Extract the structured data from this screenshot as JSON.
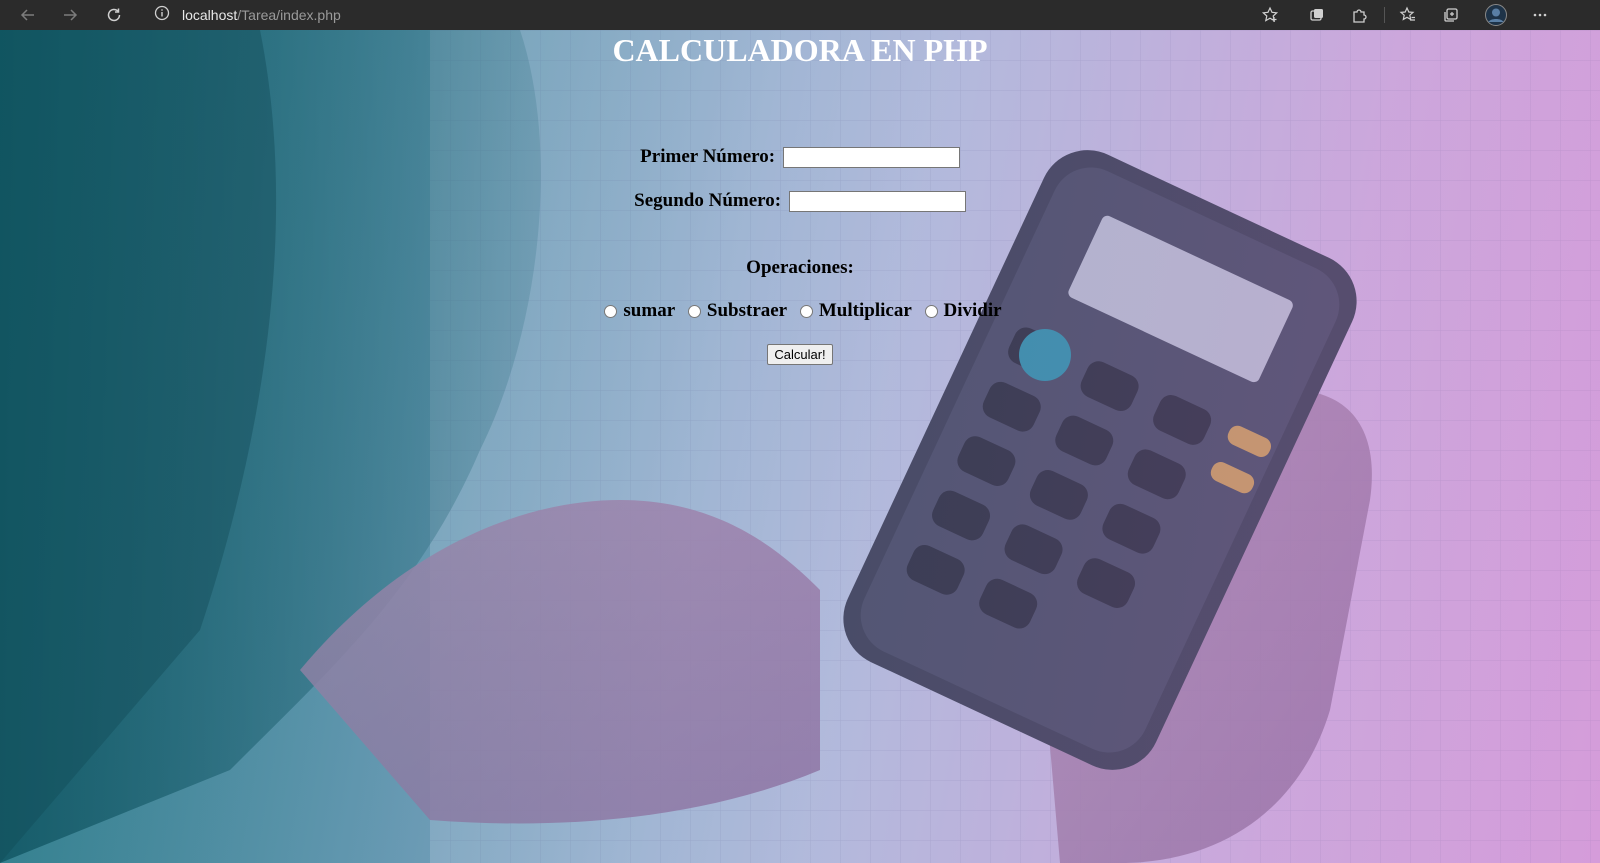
{
  "browser": {
    "url_host": "localhost",
    "url_path": "/Tarea/index.php",
    "icons": [
      "back-icon",
      "forward-icon",
      "reload-icon",
      "info-icon",
      "favorite-add-icon",
      "tab-actions-icon",
      "extensions-icon",
      "favorites-icon",
      "collections-icon",
      "profile-avatar",
      "more-icon"
    ]
  },
  "page": {
    "title": "CALCULADORA EN PHP",
    "first_label": "Primer Número:",
    "first_value": "",
    "second_label": "Segundo Número:",
    "second_value": "",
    "operations_label": "Operaciones:",
    "operations": [
      {
        "label": "sumar",
        "checked": false
      },
      {
        "label": "Substraer",
        "checked": false
      },
      {
        "label": "Multiplicar",
        "checked": false
      },
      {
        "label": "Dividir",
        "checked": false
      }
    ],
    "submit_label": "Calcular!"
  },
  "colors": {
    "toolbar": "#2b2b2b",
    "title_text": "#ffffff",
    "bg_teal": "#2f7f8c",
    "bg_pink": "#cf92d3"
  }
}
